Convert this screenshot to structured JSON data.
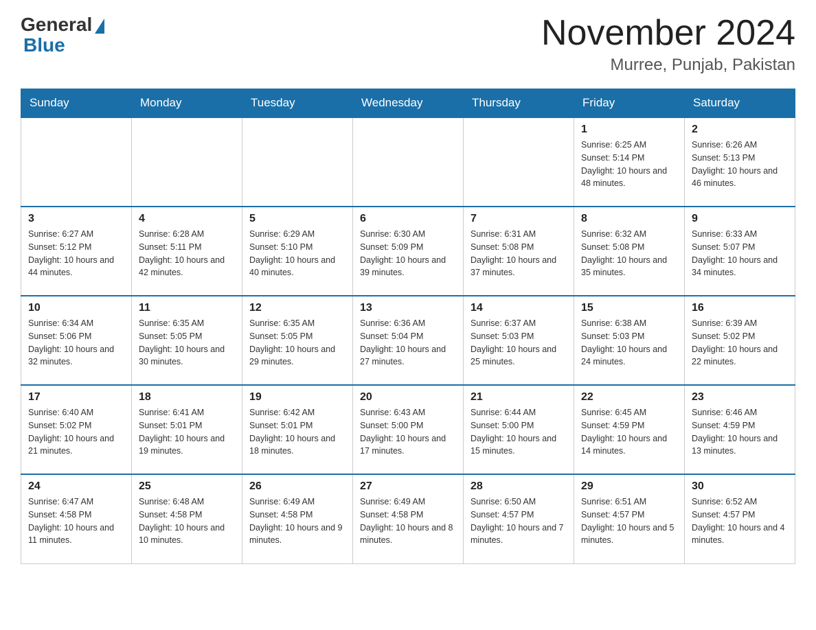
{
  "header": {
    "logo_general": "General",
    "logo_blue": "Blue",
    "month_title": "November 2024",
    "location": "Murree, Punjab, Pakistan"
  },
  "days_of_week": [
    "Sunday",
    "Monday",
    "Tuesday",
    "Wednesday",
    "Thursday",
    "Friday",
    "Saturday"
  ],
  "weeks": [
    [
      {
        "day": "",
        "info": ""
      },
      {
        "day": "",
        "info": ""
      },
      {
        "day": "",
        "info": ""
      },
      {
        "day": "",
        "info": ""
      },
      {
        "day": "",
        "info": ""
      },
      {
        "day": "1",
        "info": "Sunrise: 6:25 AM\nSunset: 5:14 PM\nDaylight: 10 hours and 48 minutes."
      },
      {
        "day": "2",
        "info": "Sunrise: 6:26 AM\nSunset: 5:13 PM\nDaylight: 10 hours and 46 minutes."
      }
    ],
    [
      {
        "day": "3",
        "info": "Sunrise: 6:27 AM\nSunset: 5:12 PM\nDaylight: 10 hours and 44 minutes."
      },
      {
        "day": "4",
        "info": "Sunrise: 6:28 AM\nSunset: 5:11 PM\nDaylight: 10 hours and 42 minutes."
      },
      {
        "day": "5",
        "info": "Sunrise: 6:29 AM\nSunset: 5:10 PM\nDaylight: 10 hours and 40 minutes."
      },
      {
        "day": "6",
        "info": "Sunrise: 6:30 AM\nSunset: 5:09 PM\nDaylight: 10 hours and 39 minutes."
      },
      {
        "day": "7",
        "info": "Sunrise: 6:31 AM\nSunset: 5:08 PM\nDaylight: 10 hours and 37 minutes."
      },
      {
        "day": "8",
        "info": "Sunrise: 6:32 AM\nSunset: 5:08 PM\nDaylight: 10 hours and 35 minutes."
      },
      {
        "day": "9",
        "info": "Sunrise: 6:33 AM\nSunset: 5:07 PM\nDaylight: 10 hours and 34 minutes."
      }
    ],
    [
      {
        "day": "10",
        "info": "Sunrise: 6:34 AM\nSunset: 5:06 PM\nDaylight: 10 hours and 32 minutes."
      },
      {
        "day": "11",
        "info": "Sunrise: 6:35 AM\nSunset: 5:05 PM\nDaylight: 10 hours and 30 minutes."
      },
      {
        "day": "12",
        "info": "Sunrise: 6:35 AM\nSunset: 5:05 PM\nDaylight: 10 hours and 29 minutes."
      },
      {
        "day": "13",
        "info": "Sunrise: 6:36 AM\nSunset: 5:04 PM\nDaylight: 10 hours and 27 minutes."
      },
      {
        "day": "14",
        "info": "Sunrise: 6:37 AM\nSunset: 5:03 PM\nDaylight: 10 hours and 25 minutes."
      },
      {
        "day": "15",
        "info": "Sunrise: 6:38 AM\nSunset: 5:03 PM\nDaylight: 10 hours and 24 minutes."
      },
      {
        "day": "16",
        "info": "Sunrise: 6:39 AM\nSunset: 5:02 PM\nDaylight: 10 hours and 22 minutes."
      }
    ],
    [
      {
        "day": "17",
        "info": "Sunrise: 6:40 AM\nSunset: 5:02 PM\nDaylight: 10 hours and 21 minutes."
      },
      {
        "day": "18",
        "info": "Sunrise: 6:41 AM\nSunset: 5:01 PM\nDaylight: 10 hours and 19 minutes."
      },
      {
        "day": "19",
        "info": "Sunrise: 6:42 AM\nSunset: 5:01 PM\nDaylight: 10 hours and 18 minutes."
      },
      {
        "day": "20",
        "info": "Sunrise: 6:43 AM\nSunset: 5:00 PM\nDaylight: 10 hours and 17 minutes."
      },
      {
        "day": "21",
        "info": "Sunrise: 6:44 AM\nSunset: 5:00 PM\nDaylight: 10 hours and 15 minutes."
      },
      {
        "day": "22",
        "info": "Sunrise: 6:45 AM\nSunset: 4:59 PM\nDaylight: 10 hours and 14 minutes."
      },
      {
        "day": "23",
        "info": "Sunrise: 6:46 AM\nSunset: 4:59 PM\nDaylight: 10 hours and 13 minutes."
      }
    ],
    [
      {
        "day": "24",
        "info": "Sunrise: 6:47 AM\nSunset: 4:58 PM\nDaylight: 10 hours and 11 minutes."
      },
      {
        "day": "25",
        "info": "Sunrise: 6:48 AM\nSunset: 4:58 PM\nDaylight: 10 hours and 10 minutes."
      },
      {
        "day": "26",
        "info": "Sunrise: 6:49 AM\nSunset: 4:58 PM\nDaylight: 10 hours and 9 minutes."
      },
      {
        "day": "27",
        "info": "Sunrise: 6:49 AM\nSunset: 4:58 PM\nDaylight: 10 hours and 8 minutes."
      },
      {
        "day": "28",
        "info": "Sunrise: 6:50 AM\nSunset: 4:57 PM\nDaylight: 10 hours and 7 minutes."
      },
      {
        "day": "29",
        "info": "Sunrise: 6:51 AM\nSunset: 4:57 PM\nDaylight: 10 hours and 5 minutes."
      },
      {
        "day": "30",
        "info": "Sunrise: 6:52 AM\nSunset: 4:57 PM\nDaylight: 10 hours and 4 minutes."
      }
    ]
  ]
}
